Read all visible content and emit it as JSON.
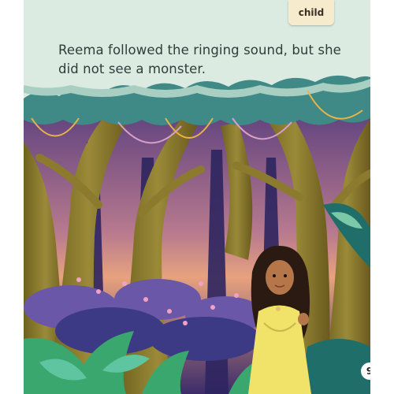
{
  "label_tab": {
    "text": "child"
  },
  "story": {
    "text": "Reema followed the ringing sound, but she did not see a monster."
  },
  "page_number": "9",
  "colors": {
    "sky": "#dcebe2",
    "canopy": "#3f8a86",
    "trunk": "#8c7a2e",
    "night_back": "#3a2f6b",
    "dress": "#f1e36a",
    "vine": "#e7b24a"
  }
}
